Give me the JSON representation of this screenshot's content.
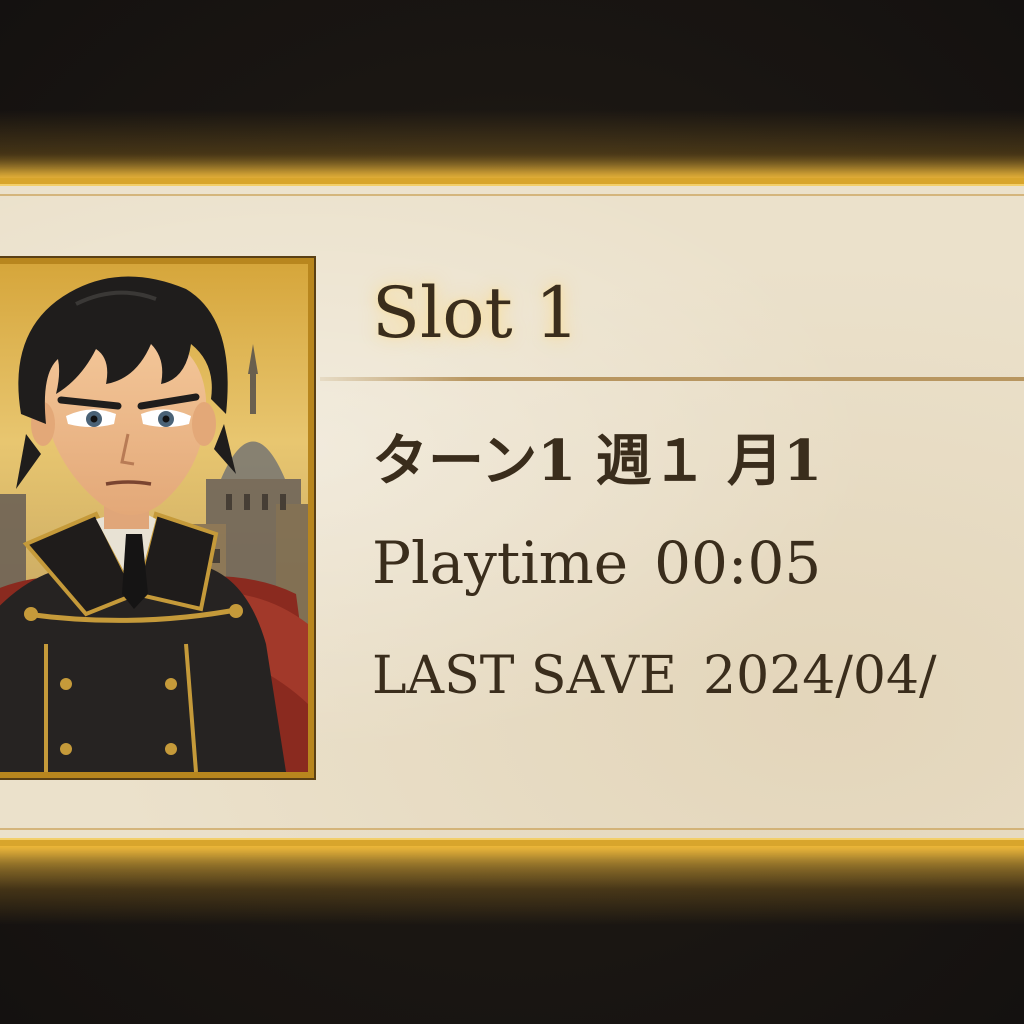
{
  "slot": {
    "title": "Slot 1",
    "turn_text": "ターン1 週１ 月1",
    "playtime_label": "Playtime",
    "playtime_value": "00:05",
    "last_save_label": "LAST SAVE",
    "last_save_value": "2024/04/"
  },
  "portrait": {
    "subject": "character-portrait",
    "colors": {
      "hair": "#1f1d1c",
      "coat": "#262322",
      "cape": "#8a2a1f",
      "trim": "#c59a3a",
      "sky": "#e2bd5e"
    }
  },
  "theme": {
    "frame_gold": "#d8a52c",
    "parchment": "#ebe1cb",
    "text": "#3a2d1c",
    "background": "#1a1612"
  }
}
